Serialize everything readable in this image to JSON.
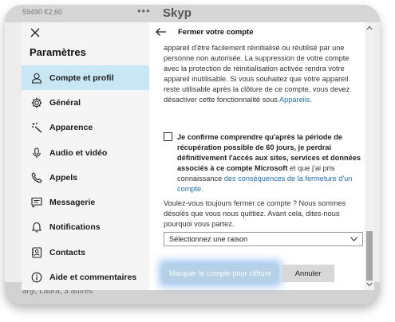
{
  "background": {
    "credit_text": "59490  €2,60",
    "dots": "•••",
    "title_fragment": "Skyp",
    "footer_text": "anji, Laura, 3 autres"
  },
  "settings": {
    "title": "Paramètres",
    "items": [
      {
        "label": "Compte et profil",
        "icon": "person-icon",
        "active": true
      },
      {
        "label": "Général",
        "icon": "gear-icon"
      },
      {
        "label": "Apparence",
        "icon": "magic-wand-icon"
      },
      {
        "label": "Audio et vidéo",
        "icon": "microphone-icon"
      },
      {
        "label": "Appels",
        "icon": "phone-icon"
      },
      {
        "label": "Messagerie",
        "icon": "chat-icon"
      },
      {
        "label": "Notifications",
        "icon": "bell-icon"
      },
      {
        "label": "Contacts",
        "icon": "contacts-icon"
      },
      {
        "label": "Aide et commentaires",
        "icon": "info-icon"
      }
    ]
  },
  "dialog": {
    "title": "Fermer votre compte",
    "intro_text": "appareil d'être facilement réinitialisé ou réutilisé par une personne non autorisée. La suppression de votre compte avec la protection de réinitialisation activée rendra votre appareil inutilisable. Si vous souhaitez que votre appareil reste utilisable après la clôture de ce compte, vous devez désactiver cette fonctionnalité sous",
    "intro_link": "Appareils",
    "intro_end": ".",
    "confirm_bold": "Je confirme comprendre qu'après la période de récupération possible de 60 jours, je perdrai définitivement l'accès aux sites, services et données associés à ce compte Microsoft",
    "confirm_plain": " et que j'ai pris connaissance ",
    "confirm_link": "des conséquences de la fermeture d'un compte",
    "confirm_end": ".",
    "question": "Voulez-vous toujours fermer ce compte ? Nous sommes désolés que vous nous quittiez. Avant cela, dites-nous pourquoi vous partez.",
    "select_placeholder": "Sélectionnez une raison",
    "primary_button": "Marquer le compte pour clôture",
    "secondary_button": "Annuler"
  },
  "colors": {
    "active_nav": "#c9e6f4",
    "link": "#1d6fb5",
    "primary_disabled": "#b6d1e6",
    "focus_glow": "#4892de"
  }
}
